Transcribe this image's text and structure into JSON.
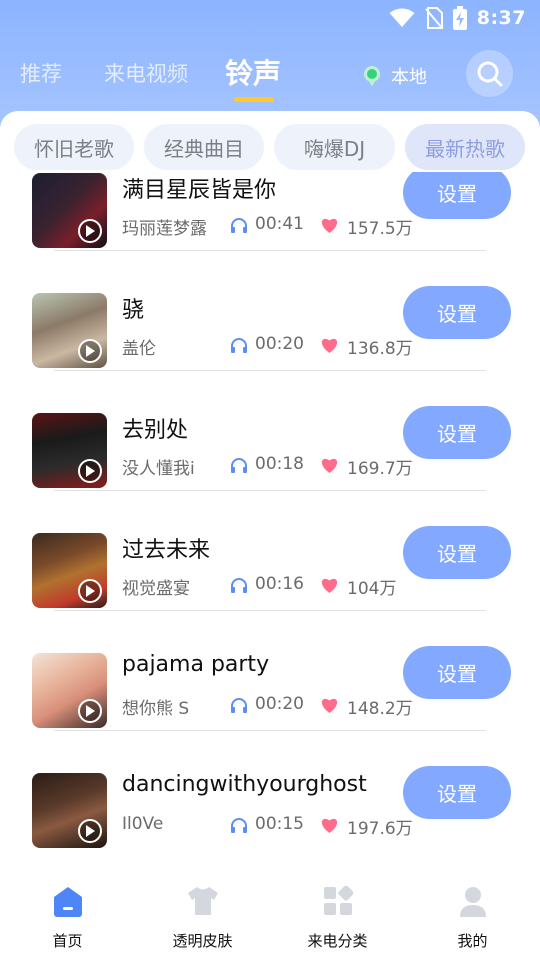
{
  "status": {
    "time": "8:37",
    "icons": [
      "wifi-icon",
      "no-sim-icon",
      "battery-charging-icon"
    ]
  },
  "nav": {
    "tabs": [
      {
        "label": "推荐",
        "active": false
      },
      {
        "label": "来电视频",
        "active": false
      },
      {
        "label": "铃声",
        "active": true
      }
    ],
    "location_label": "本地",
    "search_icon": "search-icon"
  },
  "categories": [
    {
      "label": "怀旧老歌",
      "selected": false
    },
    {
      "label": "经典曲目",
      "selected": false
    },
    {
      "label": "嗨爆DJ",
      "selected": false
    },
    {
      "label": "最新热歌",
      "selected": true
    }
  ],
  "ringtones": [
    {
      "title": "满目星辰皆是你",
      "artist": "玛丽莲梦露",
      "duration": "00:41",
      "likes": "157.5万",
      "button": "设置"
    },
    {
      "title": "骁",
      "artist": "盖伦",
      "duration": "00:20",
      "likes": "136.8万",
      "button": "设置"
    },
    {
      "title": "去别处",
      "artist": "没人懂我i",
      "duration": "00:18",
      "likes": "169.7万",
      "button": "设置"
    },
    {
      "title": "过去未来",
      "artist": "视觉盛宴",
      "duration": "00:16",
      "likes": "104万",
      "button": "设置"
    },
    {
      "title": "pajama party",
      "artist": "想你熊 S",
      "duration": "00:20",
      "likes": "148.2万",
      "button": "设置"
    },
    {
      "title": "dancingwithyourghost",
      "artist": "Il0Ve",
      "duration": "00:15",
      "likes": "197.6万",
      "button": "设置"
    }
  ],
  "bottom_nav": [
    {
      "label": "首页",
      "icon": "home-icon",
      "active": true
    },
    {
      "label": "透明皮肤",
      "icon": "tshirt-icon",
      "active": false
    },
    {
      "label": "来电分类",
      "icon": "category-grid-icon",
      "active": false
    },
    {
      "label": "我的",
      "icon": "profile-icon",
      "active": false
    }
  ],
  "colors": {
    "header_gradient_top": "#8cb4ff",
    "accent_button": "#82a8ff",
    "tab_indicator": "#ffc928",
    "heart": "#ff6b8a",
    "headphone": "#5b8ff5",
    "location_dot": "#34d27a"
  }
}
